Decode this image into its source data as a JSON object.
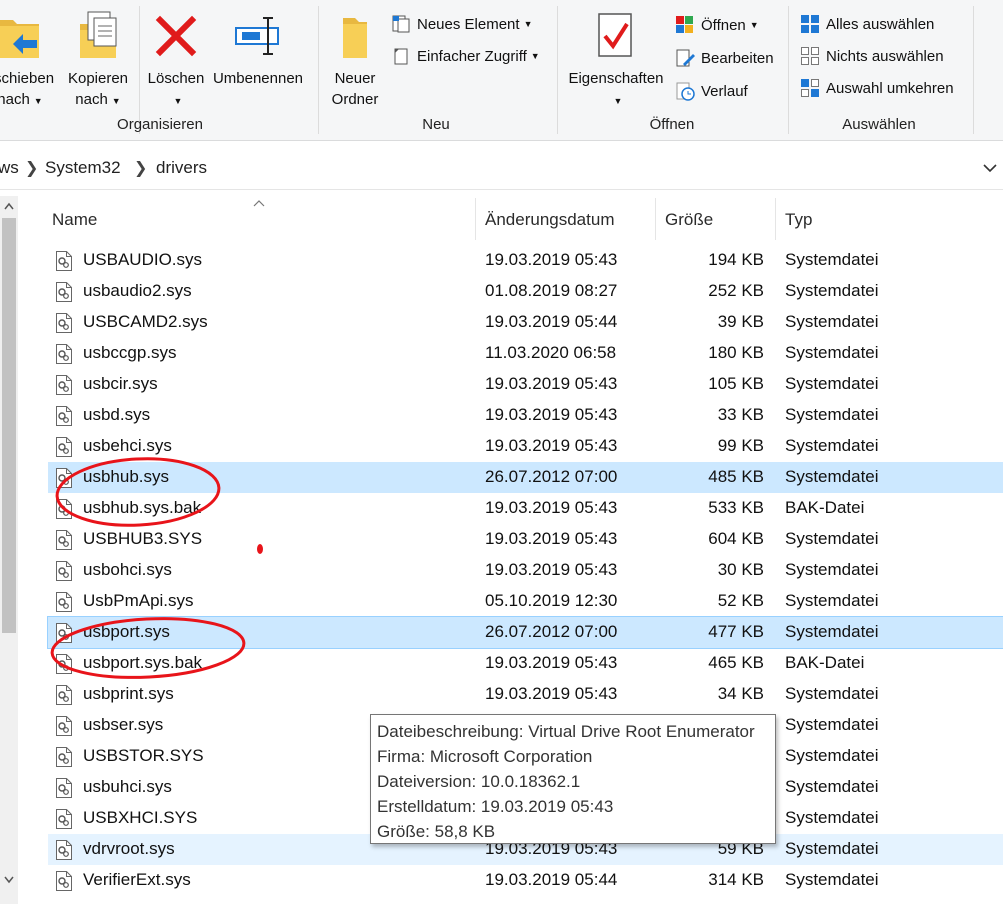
{
  "ribbon": {
    "organisieren": {
      "verschieben_line1": "schieben",
      "verschieben_line2": "nach",
      "kopieren_line1": "Kopieren",
      "kopieren_line2": "nach",
      "loeschen": "Löschen",
      "umbenennen": "Umbenennen",
      "group_label": "Organisieren"
    },
    "neu": {
      "neuer_ordner_line1": "Neuer",
      "neuer_ordner_line2": "Ordner",
      "neues_element": "Neues Element",
      "einfacher_zugriff": "Einfacher Zugriff",
      "group_label": "Neu"
    },
    "oeffnen": {
      "eigenschaften": "Eigenschaften",
      "oeffnen": "Öffnen",
      "bearbeiten": "Bearbeiten",
      "verlauf": "Verlauf",
      "group_label": "Öffnen"
    },
    "auswaehlen": {
      "alles": "Alles auswählen",
      "nichts": "Nichts auswählen",
      "umkehren": "Auswahl umkehren",
      "group_label": "Auswählen"
    }
  },
  "address": {
    "crumbs": [
      "ws",
      "System32",
      "drivers"
    ]
  },
  "columns": {
    "name": "Name",
    "date": "Änderungsdatum",
    "size": "Größe",
    "type": "Typ"
  },
  "files": [
    {
      "name": "USBAUDIO.sys",
      "date": "19.03.2019 05:43",
      "size": "194 KB",
      "type": "Systemdatei"
    },
    {
      "name": "usbaudio2.sys",
      "date": "01.08.2019 08:27",
      "size": "252 KB",
      "type": "Systemdatei"
    },
    {
      "name": "USBCAMD2.sys",
      "date": "19.03.2019 05:44",
      "size": "39 KB",
      "type": "Systemdatei"
    },
    {
      "name": "usbccgp.sys",
      "date": "11.03.2020 06:58",
      "size": "180 KB",
      "type": "Systemdatei"
    },
    {
      "name": "usbcir.sys",
      "date": "19.03.2019 05:43",
      "size": "105 KB",
      "type": "Systemdatei"
    },
    {
      "name": "usbd.sys",
      "date": "19.03.2019 05:43",
      "size": "33 KB",
      "type": "Systemdatei"
    },
    {
      "name": "usbehci.sys",
      "date": "19.03.2019 05:43",
      "size": "99 KB",
      "type": "Systemdatei"
    },
    {
      "name": "usbhub.sys",
      "date": "26.07.2012 07:00",
      "size": "485 KB",
      "type": "Systemdatei"
    },
    {
      "name": "usbhub.sys.bak",
      "date": "19.03.2019 05:43",
      "size": "533 KB",
      "type": "BAK-Datei"
    },
    {
      "name": "USBHUB3.SYS",
      "date": "19.03.2019 05:43",
      "size": "604 KB",
      "type": "Systemdatei"
    },
    {
      "name": "usbohci.sys",
      "date": "19.03.2019 05:43",
      "size": "30 KB",
      "type": "Systemdatei"
    },
    {
      "name": "UsbPmApi.sys",
      "date": "05.10.2019 12:30",
      "size": "52 KB",
      "type": "Systemdatei"
    },
    {
      "name": "usbport.sys",
      "date": "26.07.2012 07:00",
      "size": "477 KB",
      "type": "Systemdatei"
    },
    {
      "name": "usbport.sys.bak",
      "date": "19.03.2019 05:43",
      "size": "465 KB",
      "type": "BAK-Datei"
    },
    {
      "name": "usbprint.sys",
      "date": "19.03.2019 05:43",
      "size": "34 KB",
      "type": "Systemdatei"
    },
    {
      "name": "usbser.sys",
      "date": "",
      "size": "",
      "type": "Systemdatei"
    },
    {
      "name": "USBSTOR.SYS",
      "date": "",
      "size": "",
      "type": "Systemdatei"
    },
    {
      "name": "usbuhci.sys",
      "date": "",
      "size": "",
      "type": "Systemdatei"
    },
    {
      "name": "USBXHCI.SYS",
      "date": "",
      "size": "",
      "type": "Systemdatei"
    },
    {
      "name": "vdrvroot.sys",
      "date": "19.03.2019 05:43",
      "size": "59 KB",
      "type": "Systemdatei"
    },
    {
      "name": "VerifierExt.sys",
      "date": "19.03.2019 05:44",
      "size": "314 KB",
      "type": "Systemdatei"
    }
  ],
  "tooltip": {
    "line1": "Dateibeschreibung: Virtual Drive Root Enumerator",
    "line2": "Firma: Microsoft Corporation",
    "line3": "Dateiversion: 10.0.18362.1",
    "line4": "Erstelldatum: 19.03.2019 05:43",
    "line5": "Größe: 58,8 KB"
  },
  "colors": {
    "selection": "#cce8ff",
    "hover": "#e5f3ff",
    "annotation": "#e8141a"
  }
}
